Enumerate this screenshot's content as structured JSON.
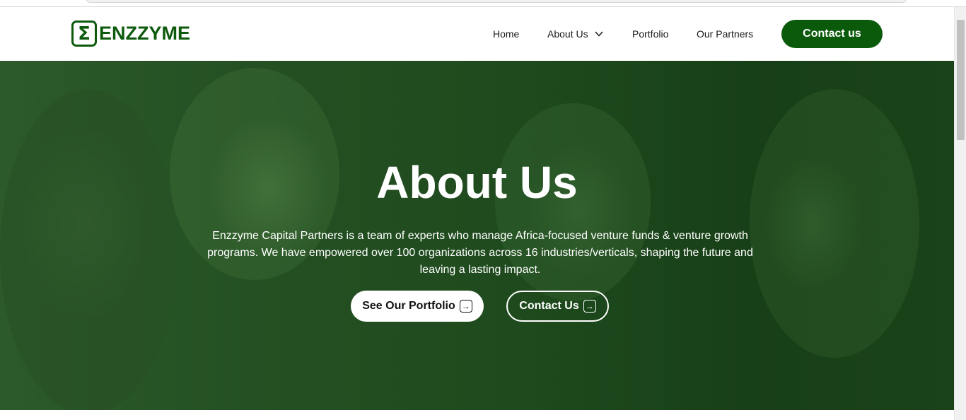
{
  "brand": {
    "name": "ENZZYME",
    "logo_glyph": "Σ",
    "color": "#0d5a0d"
  },
  "nav": {
    "home": "Home",
    "about": "About Us",
    "portfolio": "Portfolio",
    "partners": "Our Partners",
    "contact": "Contact us",
    "about_icon": "chevron-down-icon"
  },
  "hero": {
    "title": "About Us",
    "description": "Enzzyme Capital Partners is a team of experts who manage Africa-focused venture funds & venture growth programs. We have empowered over 100 organizations across 16 industries/verticals, shaping the future and leaving a lasting impact.",
    "primary_button": "See Our Portfolio",
    "secondary_button": "Contact Us",
    "button_icon": "arrow-right-icon",
    "arrow_glyph": "→",
    "overlay_color": "#1e4a1d"
  },
  "colors": {
    "accent": "#0b5a0b",
    "white": "#ffffff"
  }
}
